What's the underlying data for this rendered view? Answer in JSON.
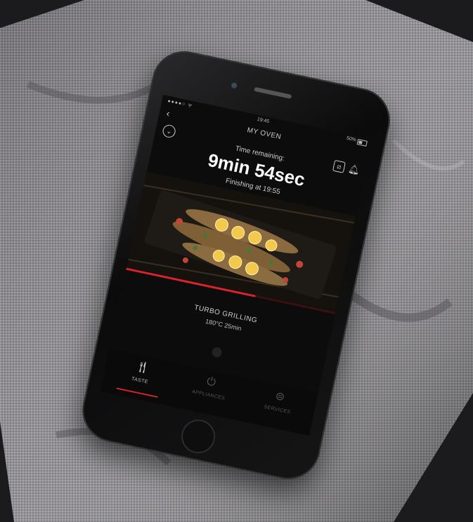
{
  "status_bar": {
    "signal": "●●●●○ ᯤ",
    "time": "19:45",
    "battery": "50%"
  },
  "nav": {
    "back_icon": "‹",
    "title": "MY OVEN"
  },
  "header": {
    "collapse_icon": "chevron-circle-icon",
    "connection_icon": "no-connection-icon",
    "notification_icon": "bell-icon"
  },
  "timer": {
    "label": "Time remaining:",
    "value": "9min 54sec",
    "finishing": "Finishing at 19:55"
  },
  "cooking": {
    "mode": "TURBO GRILLING",
    "details": "180°C  25min",
    "progress": 0.62
  },
  "tabs": [
    {
      "label": "TASTE",
      "icon": "fork-knife-icon",
      "active": true
    },
    {
      "label": "APPLIANCES",
      "icon": "power-icon",
      "active": false
    },
    {
      "label": "SERVICES",
      "icon": "menu-circle-icon",
      "active": false
    }
  ],
  "colors": {
    "accent": "#d8232a",
    "screen_bg": "#0c0c0d",
    "fabric": "#8c8a8e"
  }
}
